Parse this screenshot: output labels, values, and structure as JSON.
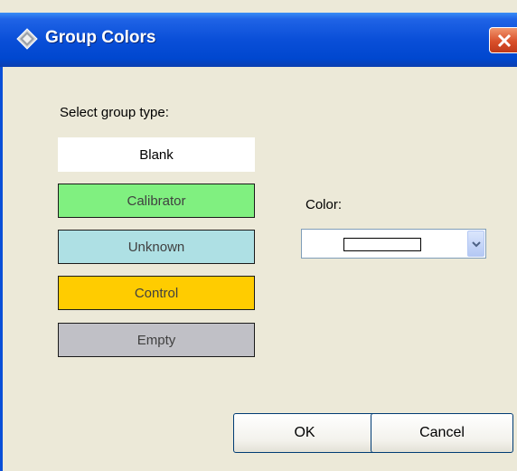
{
  "window": {
    "title": "Group Colors"
  },
  "select_label": "Select group type:",
  "groups": [
    {
      "label": "Blank"
    },
    {
      "label": "Calibrator",
      "color": "#80f080"
    },
    {
      "label": "Unknown",
      "color": "#aee0e4"
    },
    {
      "label": "Control",
      "color": "#ffcc00"
    },
    {
      "label": "Empty",
      "color": "#c0c0c6"
    }
  ],
  "color_label": "Color:",
  "color_select": {
    "selected_color": "#ffffff"
  },
  "buttons": {
    "ok": "OK",
    "cancel": "Cancel"
  }
}
